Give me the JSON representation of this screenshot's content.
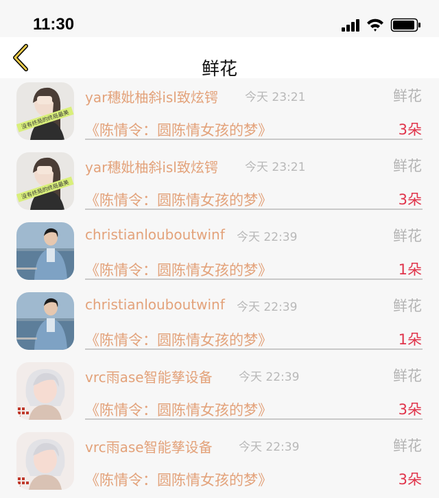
{
  "status": {
    "time": "11:30"
  },
  "nav": {
    "title": "鲜花",
    "back_icon": "chevron-left-icon",
    "accent": "#e8c94a"
  },
  "colors": {
    "name": "#e3a27a",
    "time": "#b8b8b8",
    "count": "#e0334a",
    "type": "#b4b4b4"
  },
  "items": [
    {
      "name": "yar穗妣柚斜isl致炫锷",
      "time": "今天 23:21",
      "type": "鲜花",
      "drama": "《陈情令：圆陈情女孩的梦》",
      "count": "3朵",
      "avatar_caption": "没有终局的终局最美"
    },
    {
      "name": "yar穗妣柚斜isl致炫锷",
      "time": "今天 23:21",
      "type": "鲜花",
      "drama": "《陈情令：圆陈情女孩的梦》",
      "count": "3朵",
      "avatar_caption": "没有终局的终局最美"
    },
    {
      "name": "christianlouboutwinf",
      "time": "今天 22:39",
      "type": "鲜花",
      "drama": "《陈情令：圆陈情女孩的梦》",
      "count": "1朵",
      "avatar_caption": ""
    },
    {
      "name": "christianlouboutwinf",
      "time": "今天 22:39",
      "type": "鲜花",
      "drama": "《陈情令：圆陈情女孩的梦》",
      "count": "1朵",
      "avatar_caption": ""
    },
    {
      "name": "vrc雨ase智能孳设备",
      "time": "今天 22:39",
      "type": "鲜花",
      "drama": "《陈情令：圆陈情女孩的梦》",
      "count": "3朵",
      "avatar_caption": ""
    },
    {
      "name": "vrc雨ase智能孳设备",
      "time": "今天 22:39",
      "type": "鲜花",
      "drama": "《陈情令：圆陈情女孩的梦》",
      "count": "3朵",
      "avatar_caption": ""
    }
  ]
}
